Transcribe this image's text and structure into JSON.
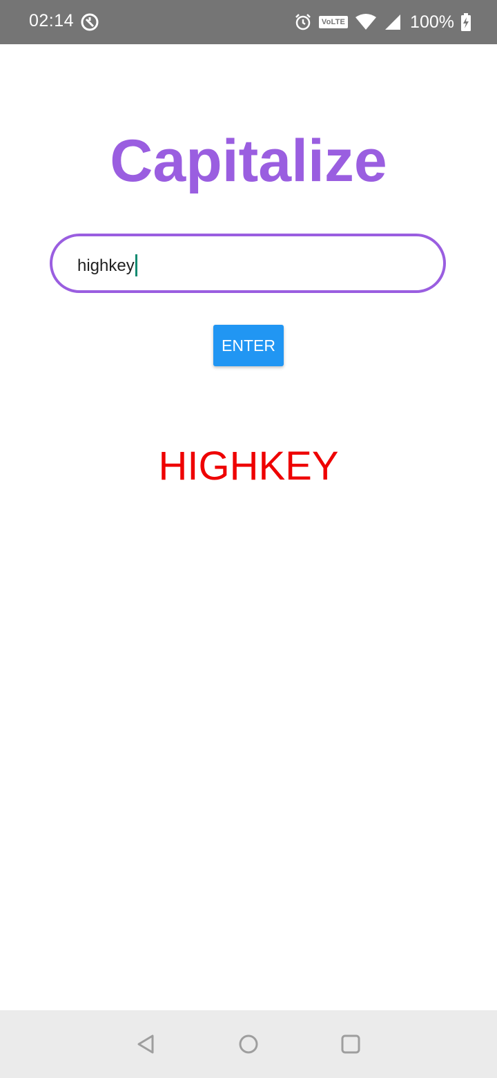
{
  "status_bar": {
    "time": "02:14",
    "network_badge": "VoLTE",
    "battery": "100%",
    "icons": [
      "app-notification-icon",
      "alarm-icon",
      "volte-icon",
      "wifi-icon",
      "signal-icon",
      "battery-charging-icon"
    ]
  },
  "app": {
    "title": "Capitalize",
    "input_value": "highkey",
    "button_label": "ENTER",
    "result": "HIGHKEY"
  },
  "nav_bar": {
    "icons": [
      "back-icon",
      "home-icon",
      "recents-icon"
    ]
  },
  "colors": {
    "accent": "#9a5ee0",
    "button": "#2196f3",
    "result": "#ee0000",
    "status_bar": "#757575",
    "nav_bar": "#ebebeb"
  }
}
